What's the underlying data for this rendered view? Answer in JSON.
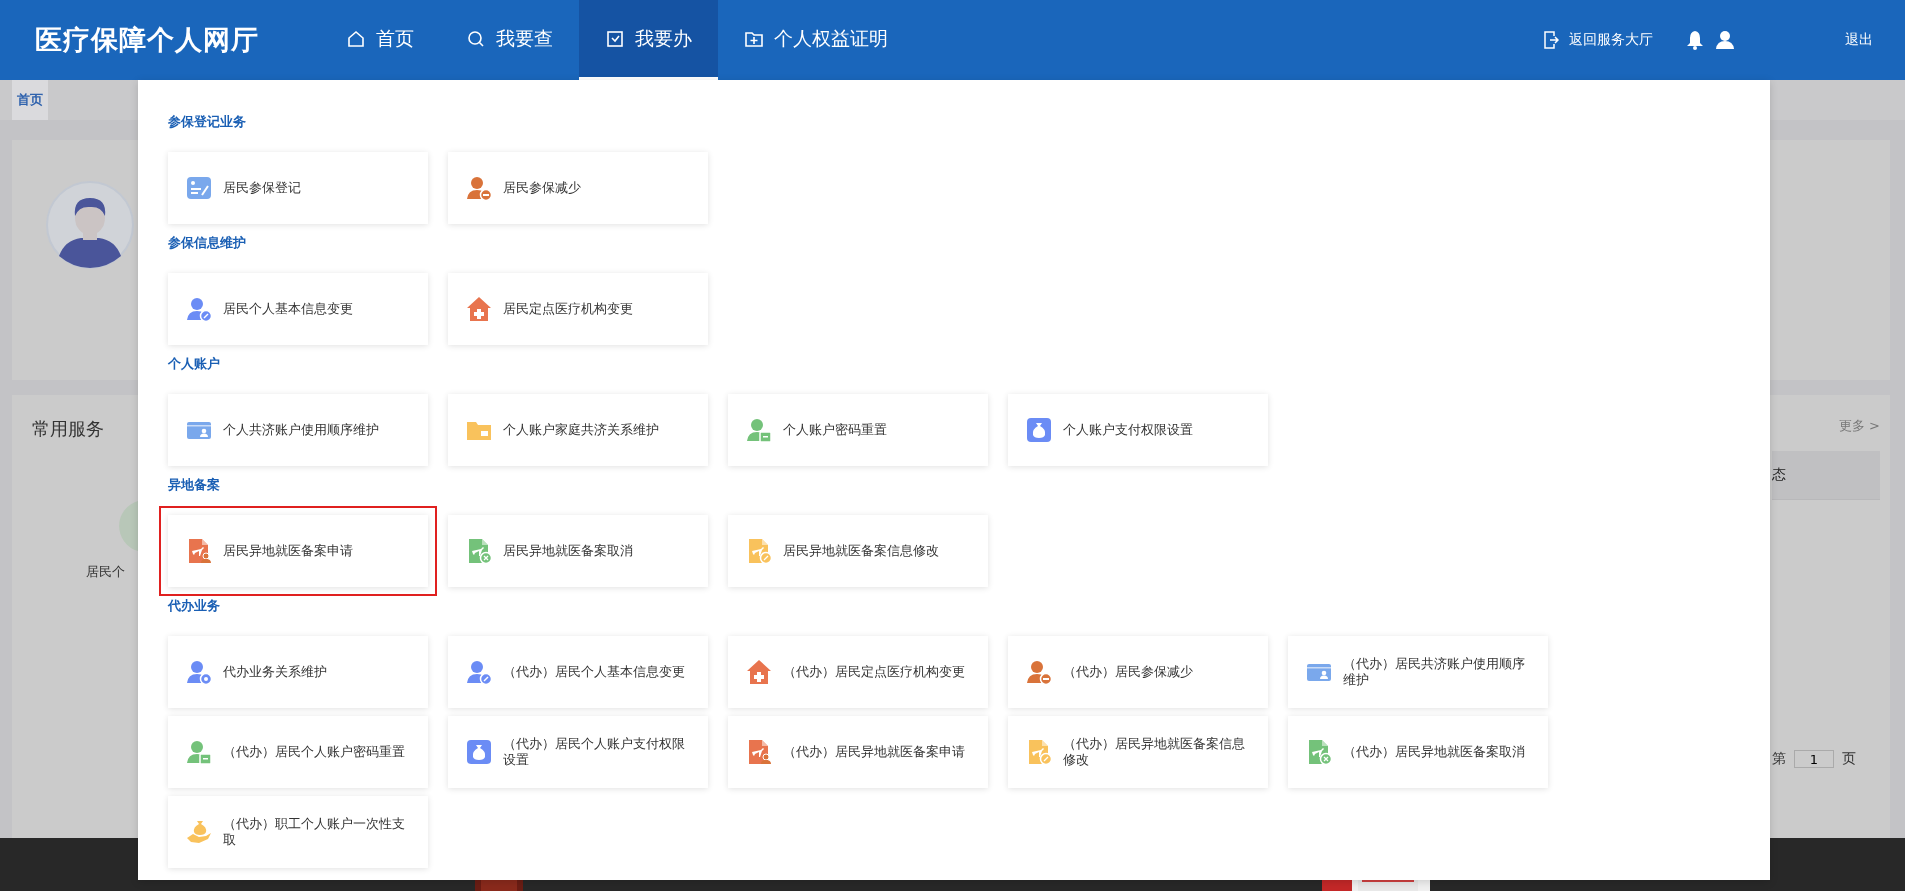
{
  "header": {
    "logo": "医疗保障个人网厅",
    "nav": [
      {
        "label": "首页",
        "kind": "home",
        "selected": false
      },
      {
        "label": "我要查",
        "kind": "search",
        "selected": false
      },
      {
        "label": "我要办",
        "kind": "tray",
        "selected": true
      },
      {
        "label": "个人权益证明",
        "kind": "folder",
        "selected": false
      }
    ],
    "return_link": "返回服务大厅",
    "logout": "退出"
  },
  "breadcrumb": [
    {
      "label": "首页",
      "selected": true
    }
  ],
  "background": {
    "common_services_title": "常用服务",
    "service_label": "居民个",
    "more_link": "更多 >",
    "table_header": "态",
    "pagination": {
      "prefix": "第",
      "page": "1",
      "suffix": "页"
    }
  },
  "menu": {
    "sections": [
      {
        "title": "参保登记业务",
        "items": [
          {
            "label": "居民参保登记",
            "kind": "form",
            "selected": false
          },
          {
            "label": "居民参保减少",
            "kind": "person-minus",
            "selected": false
          }
        ]
      },
      {
        "title": "参保信息维护",
        "items": [
          {
            "label": "居民个人基本信息变更",
            "kind": "person-edit",
            "selected": false
          },
          {
            "label": "居民定点医疗机构变更",
            "kind": "hospital",
            "selected": false
          }
        ]
      },
      {
        "title": "个人账户",
        "items": [
          {
            "label": "个人共济账户使用顺序维护",
            "kind": "card",
            "selected": false
          },
          {
            "label": "个人账户家庭共济关系维护",
            "kind": "wallet",
            "selected": false
          },
          {
            "label": "个人账户密码重置",
            "kind": "person-card",
            "selected": false
          },
          {
            "label": "个人账户支付权限设置",
            "kind": "moneybag",
            "selected": false
          }
        ]
      },
      {
        "title": "异地备案",
        "items": [
          {
            "label": "居民异地就医备案申请",
            "kind": "doc-person",
            "selected": true
          },
          {
            "label": "居民异地就医备案取消",
            "kind": "doc-cancel",
            "selected": false
          },
          {
            "label": "居民异地就医备案信息修改",
            "kind": "doc-edit",
            "selected": false
          }
        ]
      },
      {
        "title": "代办业务",
        "items": [
          {
            "label": "代办业务关系维护",
            "kind": "person-agent",
            "selected": false
          },
          {
            "label": "（代办）居民个人基本信息变更",
            "kind": "person-edit",
            "selected": false
          },
          {
            "label": "（代办）居民定点医疗机构变更",
            "kind": "hospital",
            "selected": false
          },
          {
            "label": "（代办）居民参保减少",
            "kind": "person-minus",
            "selected": false
          },
          {
            "label": "（代办）居民共济账户使用顺序维护",
            "kind": "card",
            "selected": false
          },
          {
            "label": "（代办）居民个人账户密码重置",
            "kind": "person-card",
            "selected": false
          },
          {
            "label": "（代办）居民个人账户支付权限设置",
            "kind": "moneybag",
            "selected": false
          },
          {
            "label": "（代办）居民异地就医备案申请",
            "kind": "doc-person",
            "selected": false
          },
          {
            "label": "（代办）居民异地就医备案信息修改",
            "kind": "doc-edit",
            "selected": false
          },
          {
            "label": "（代办）居民异地就医备案取消",
            "kind": "doc-cancel",
            "selected": false
          },
          {
            "label": "（代办）职工个人账户一次性支取",
            "kind": "hand-money",
            "selected": false
          }
        ]
      }
    ]
  }
}
